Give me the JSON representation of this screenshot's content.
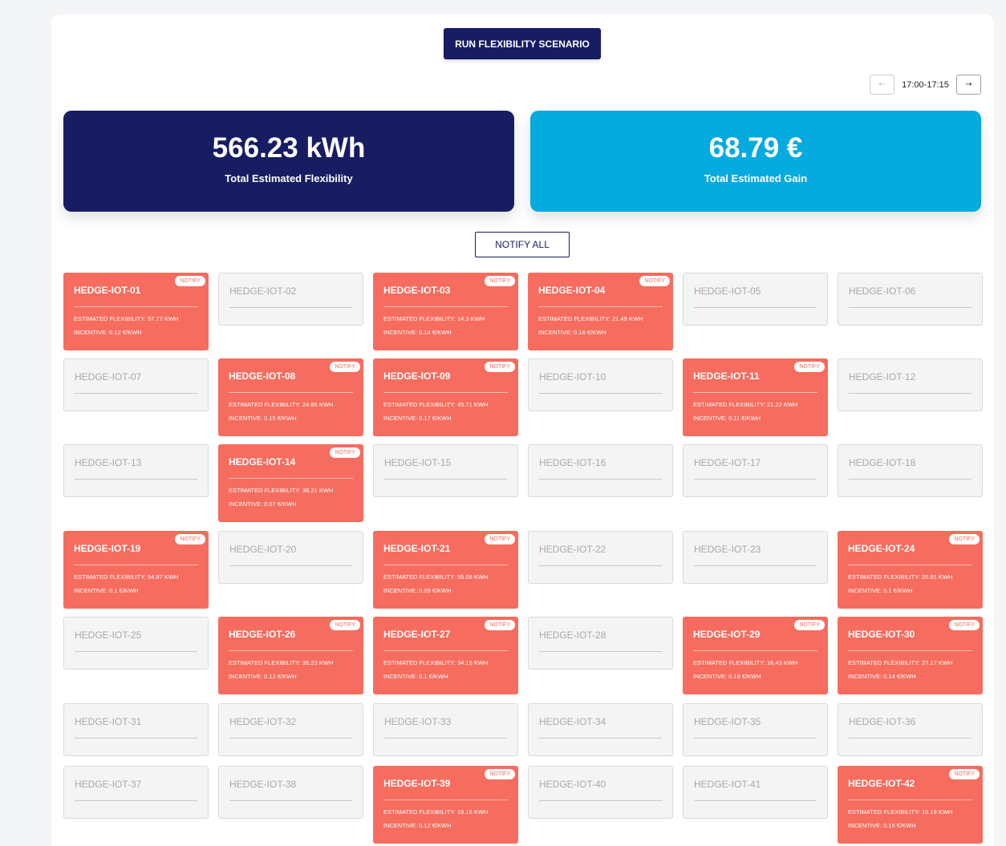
{
  "run_button": "RUN FLEXIBILITY SCENARIO",
  "pager": {
    "prev": "←",
    "label": "17:00-17:15",
    "next": "→"
  },
  "kpis": {
    "flex_value": "566.23 kWh",
    "flex_label": "Total Estimated Flexibility",
    "gain_value": "68.79 €",
    "gain_label": "Total Estimated Gain"
  },
  "notify_all": "NOTIFY ALL",
  "notify_badge": "NOTIFY",
  "colors": {
    "navy": "#171c63",
    "cyan": "#05aadf",
    "active_card": "#f66c5e",
    "inactive_card": "#f4f4f5"
  },
  "devices": [
    {
      "name": "HEDGE-IOT-01",
      "active": true,
      "flex": "ESTIMATED FLEXIBILITY: 57.77 KWH",
      "incentive": "INCENTIVE: 0.12 €/KWH"
    },
    {
      "name": "HEDGE-IOT-02",
      "active": false
    },
    {
      "name": "HEDGE-IOT-03",
      "active": true,
      "flex": "ESTIMATED FLEXIBILITY: 14.3 KWH",
      "incentive": "INCENTIVE: 0.14 €/KWH"
    },
    {
      "name": "HEDGE-IOT-04",
      "active": true,
      "flex": "ESTIMATED FLEXIBILITY: 21.49 KWH",
      "incentive": "INCENTIVE: 0.16 €/KWH"
    },
    {
      "name": "HEDGE-IOT-05",
      "active": false
    },
    {
      "name": "HEDGE-IOT-06",
      "active": false
    },
    {
      "name": "HEDGE-IOT-07",
      "active": false
    },
    {
      "name": "HEDGE-IOT-08",
      "active": true,
      "flex": "ESTIMATED FLEXIBILITY: 24.85 KWH",
      "incentive": "INCENTIVE: 0.15 €/KWH"
    },
    {
      "name": "HEDGE-IOT-09",
      "active": true,
      "flex": "ESTIMATED FLEXIBILITY: 45.71 KWH",
      "incentive": "INCENTIVE: 0.17 €/KWH"
    },
    {
      "name": "HEDGE-IOT-10",
      "active": false
    },
    {
      "name": "HEDGE-IOT-11",
      "active": true,
      "flex": "ESTIMATED FLEXIBILITY: 21.22 KWH",
      "incentive": "INCENTIVE: 0.11 €/KWH"
    },
    {
      "name": "HEDGE-IOT-12",
      "active": false
    },
    {
      "name": "HEDGE-IOT-13",
      "active": false
    },
    {
      "name": "HEDGE-IOT-14",
      "active": true,
      "flex": "ESTIMATED FLEXIBILITY: 38.21 KWH",
      "incentive": "INCENTIVE: 0.07 €/KWH"
    },
    {
      "name": "HEDGE-IOT-15",
      "active": false
    },
    {
      "name": "HEDGE-IOT-16",
      "active": false
    },
    {
      "name": "HEDGE-IOT-17",
      "active": false
    },
    {
      "name": "HEDGE-IOT-18",
      "active": false
    },
    {
      "name": "HEDGE-IOT-19",
      "active": true,
      "flex": "ESTIMATED FLEXIBILITY: 54.97 KWH",
      "incentive": "INCENTIVE: 0.1 €/KWH"
    },
    {
      "name": "HEDGE-IOT-20",
      "active": false
    },
    {
      "name": "HEDGE-IOT-21",
      "active": true,
      "flex": "ESTIMATED FLEXIBILITY: 55.08 KWH",
      "incentive": "INCENTIVE: 0.09 €/KWH"
    },
    {
      "name": "HEDGE-IOT-22",
      "active": false
    },
    {
      "name": "HEDGE-IOT-23",
      "active": false
    },
    {
      "name": "HEDGE-IOT-24",
      "active": true,
      "flex": "ESTIMATED FLEXIBILITY: 20.81 KWH",
      "incentive": "INCENTIVE: 0.1 €/KWH"
    },
    {
      "name": "HEDGE-IOT-25",
      "active": false
    },
    {
      "name": "HEDGE-IOT-26",
      "active": true,
      "flex": "ESTIMATED FLEXIBILITY: 35.23 KWH",
      "incentive": "INCENTIVE: 0.12 €/KWH"
    },
    {
      "name": "HEDGE-IOT-27",
      "active": true,
      "flex": "ESTIMATED FLEXIBILITY: 34.15 KWH",
      "incentive": "INCENTIVE: 0.1 €/KWH"
    },
    {
      "name": "HEDGE-IOT-28",
      "active": false
    },
    {
      "name": "HEDGE-IOT-29",
      "active": true,
      "flex": "ESTIMATED FLEXIBILITY: 16.43 KWH",
      "incentive": "INCENTIVE: 0.18 €/KWH"
    },
    {
      "name": "HEDGE-IOT-30",
      "active": true,
      "flex": "ESTIMATED FLEXIBILITY: 27.17 KWH",
      "incentive": "INCENTIVE: 0.14 €/KWH"
    },
    {
      "name": "HEDGE-IOT-31",
      "active": false
    },
    {
      "name": "HEDGE-IOT-32",
      "active": false
    },
    {
      "name": "HEDGE-IOT-33",
      "active": false
    },
    {
      "name": "HEDGE-IOT-34",
      "active": false
    },
    {
      "name": "HEDGE-IOT-35",
      "active": false
    },
    {
      "name": "HEDGE-IOT-36",
      "active": false
    },
    {
      "name": "HEDGE-IOT-37",
      "active": false
    },
    {
      "name": "HEDGE-IOT-38",
      "active": false
    },
    {
      "name": "HEDGE-IOT-39",
      "active": true,
      "flex": "ESTIMATED FLEXIBILITY: 19.16 KWH",
      "incentive": "INCENTIVE: 0.12 €/KWH"
    },
    {
      "name": "HEDGE-IOT-40",
      "active": false
    },
    {
      "name": "HEDGE-IOT-41",
      "active": false
    },
    {
      "name": "HEDGE-IOT-42",
      "active": true,
      "flex": "ESTIMATED FLEXIBILITY: 10.18 KWH",
      "incentive": "INCENTIVE: 0.15 €/KWH"
    }
  ]
}
